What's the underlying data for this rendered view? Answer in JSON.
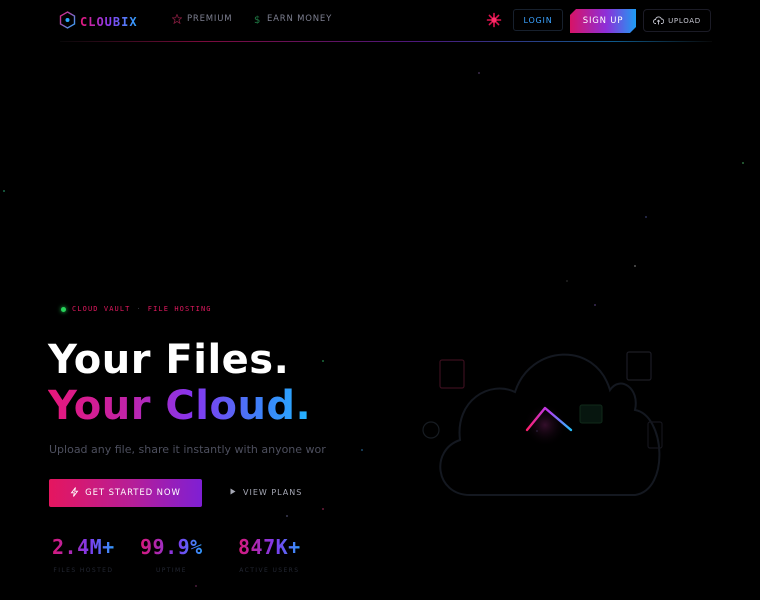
{
  "brand": {
    "name": "CLOUBIX"
  },
  "nav": {
    "premium": "PREMIUM",
    "earn_money": "EARN MONEY",
    "login": "LOGIN",
    "signup": "SIGN UP",
    "upload": "UPLOAD"
  },
  "hero": {
    "badge_left": "CLOUD VAULT",
    "badge_sep": "·",
    "badge_right": "FILE HOSTING",
    "title_line1": "Your Files.",
    "title_line2": "Your Cloud.",
    "subtitle": "Upload any file, share it instantly with anyone wor",
    "cta_primary": "GET STARTED NOW",
    "cta_secondary": "VIEW PLANS"
  },
  "stats": [
    {
      "value": "2.4M+",
      "label": "FILES HOSTED"
    },
    {
      "value": "99.9%",
      "label": "UPTIME"
    },
    {
      "value": "847K+",
      "label": "ACTIVE USERS"
    }
  ],
  "icons": {
    "logo": "hexagon-logo-icon",
    "premium": "star-icon",
    "earn": "dollar-icon",
    "spark": "sparkle-icon",
    "upload": "cloud-upload-icon",
    "cta": "lightning-icon",
    "plans": "play-icon",
    "hero": "cloud-upload-illustration"
  },
  "colors": {
    "background": "#000000",
    "pink": "#e8177a",
    "purple": "#8636ef",
    "blue": "#22b5ff",
    "green": "#27d35a"
  }
}
